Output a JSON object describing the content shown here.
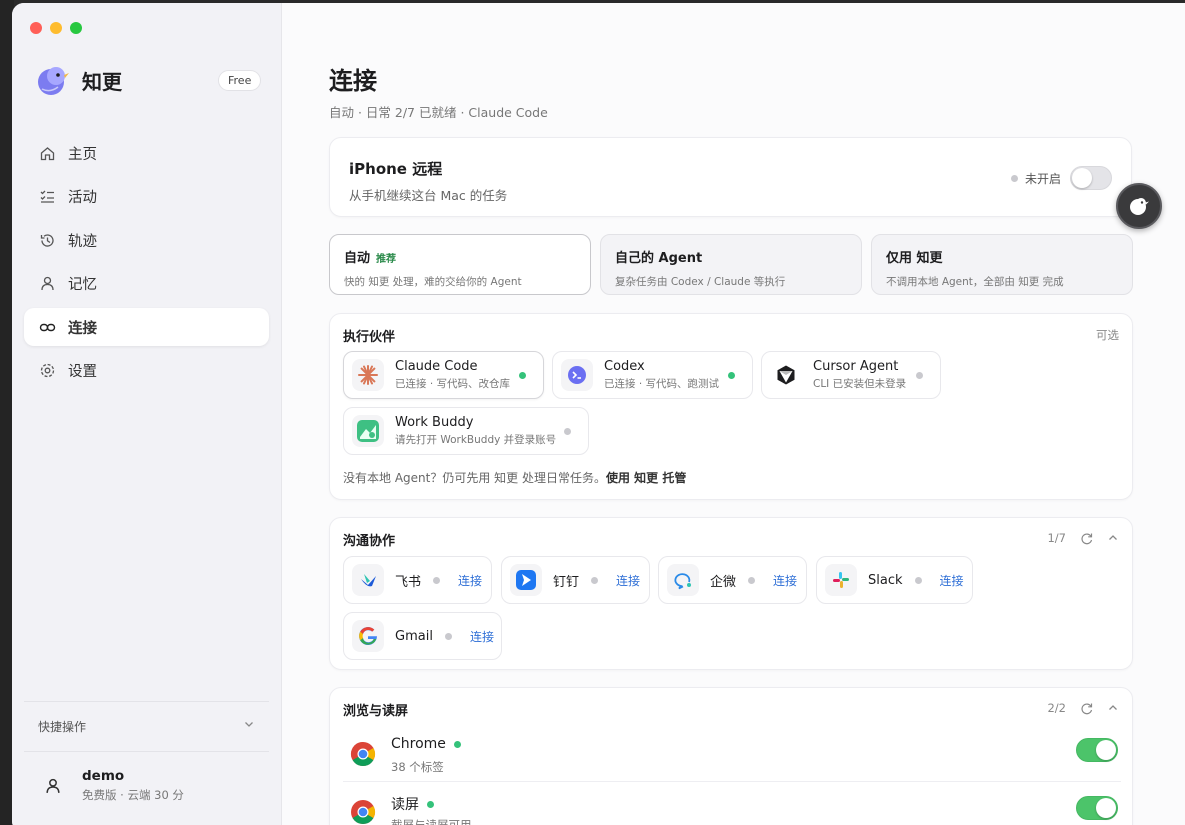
{
  "app": {
    "name": "知更",
    "plan_badge": "Free"
  },
  "sidebar": {
    "items": [
      {
        "label": "主页",
        "icon": "home-icon"
      },
      {
        "label": "活动",
        "icon": "list-icon"
      },
      {
        "label": "轨迹",
        "icon": "history-icon"
      },
      {
        "label": "记忆",
        "icon": "person-icon"
      },
      {
        "label": "连接",
        "icon": "link-icon",
        "active": true
      },
      {
        "label": "设置",
        "icon": "gear-icon"
      }
    ],
    "quick_actions": "快捷操作",
    "user": {
      "name": "demo",
      "sub": "免费版 · 云端 30 分"
    }
  },
  "page": {
    "title": "连接",
    "subtitle": "自动 · 日常 2/7 已就绪 · Claude Code"
  },
  "remote": {
    "title": "iPhone 远程",
    "subtitle": "从手机继续这台 Mac 的任务",
    "status": "未开启",
    "enabled": false
  },
  "modes": [
    {
      "title": "自动",
      "tag": "推荐",
      "sub": "快的 知更 处理，难的交给你的 Agent",
      "active": true
    },
    {
      "title": "自己的 Agent",
      "tag": "",
      "sub": "复杂任务由 Codex / Claude 等执行",
      "active": false
    },
    {
      "title": "仅用 知更",
      "tag": "",
      "sub": "不调用本地 Agent，全部由 知更 完成",
      "active": false
    }
  ],
  "agents": {
    "title": "执行伙伴",
    "right": "可选",
    "items": [
      {
        "name": "Claude Code",
        "sub": "已连接 · 写代码、改仓库",
        "connected": true
      },
      {
        "name": "Codex",
        "sub": "已连接 · 写代码、跑测试",
        "connected": true
      },
      {
        "name": "Cursor Agent",
        "sub": "CLI 已安装但未登录",
        "connected": false
      },
      {
        "name": "Work Buddy",
        "sub": "请先打开 WorkBuddy 并登录账号",
        "connected": false
      }
    ],
    "note": "没有本地 Agent？仍可先用 知更 处理日常任务。",
    "note_link": "使用 知更 托管"
  },
  "comm": {
    "title": "沟通协作",
    "count": "1/7",
    "connect_label": "连接",
    "items": [
      {
        "name": "飞书"
      },
      {
        "name": "钉钉"
      },
      {
        "name": "企微"
      },
      {
        "name": "Slack"
      },
      {
        "name": "Gmail"
      }
    ]
  },
  "browse": {
    "title": "浏览与读屏",
    "count": "2/2",
    "items": [
      {
        "name": "Chrome",
        "sub": "38 个标签",
        "enabled": true
      },
      {
        "name": "读屏",
        "sub": "截屏与读屏可用",
        "enabled": true
      }
    ]
  },
  "colors": {
    "accent_link": "#2f6fd6",
    "ok": "#34c27a",
    "toggle_on": "#4cc46a"
  }
}
